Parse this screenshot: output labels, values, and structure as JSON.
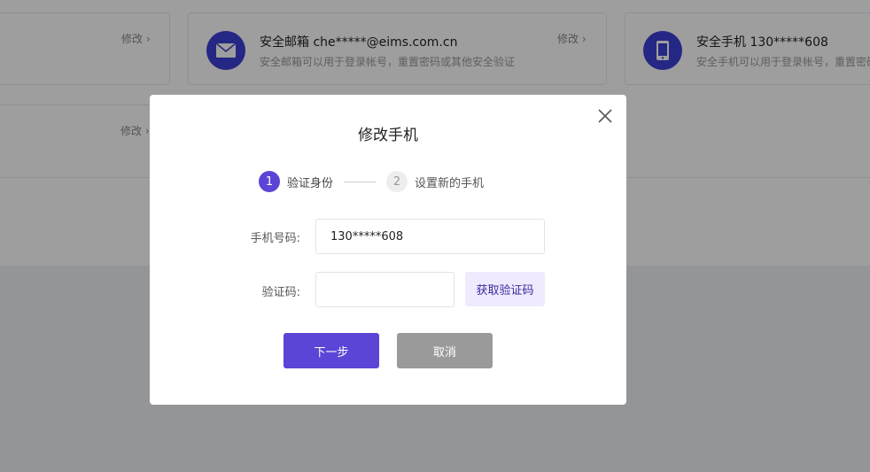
{
  "background": {
    "cards": [
      {
        "edit_label": "修改"
      },
      {
        "title": "安全邮箱 che*****@eims.com.cn",
        "desc": "安全邮箱可以用于登录帐号，重置密码或其他安全验证",
        "edit_label": "修改",
        "icon": "mail-icon"
      },
      {
        "title": "安全手机 130*****608",
        "desc": "安全手机可以用于登录帐号，重置密码",
        "edit_label": "修改",
        "icon": "mobile-icon"
      },
      {
        "edit_label": "修改"
      }
    ]
  },
  "modal": {
    "title": "修改手机",
    "steps": [
      {
        "num": "1",
        "label": "验证身份",
        "active": true
      },
      {
        "num": "2",
        "label": "设置新的手机",
        "active": false
      }
    ],
    "phone": {
      "label": "手机号码:",
      "value": "130*****608"
    },
    "code": {
      "label": "验证码:",
      "value": "",
      "button": "获取验证码"
    },
    "next_label": "下一步",
    "cancel_label": "取消"
  },
  "colors": {
    "primary": "#5b45d6",
    "icon_bg": "#3b3fd3",
    "cancel": "#9a9a9a"
  }
}
